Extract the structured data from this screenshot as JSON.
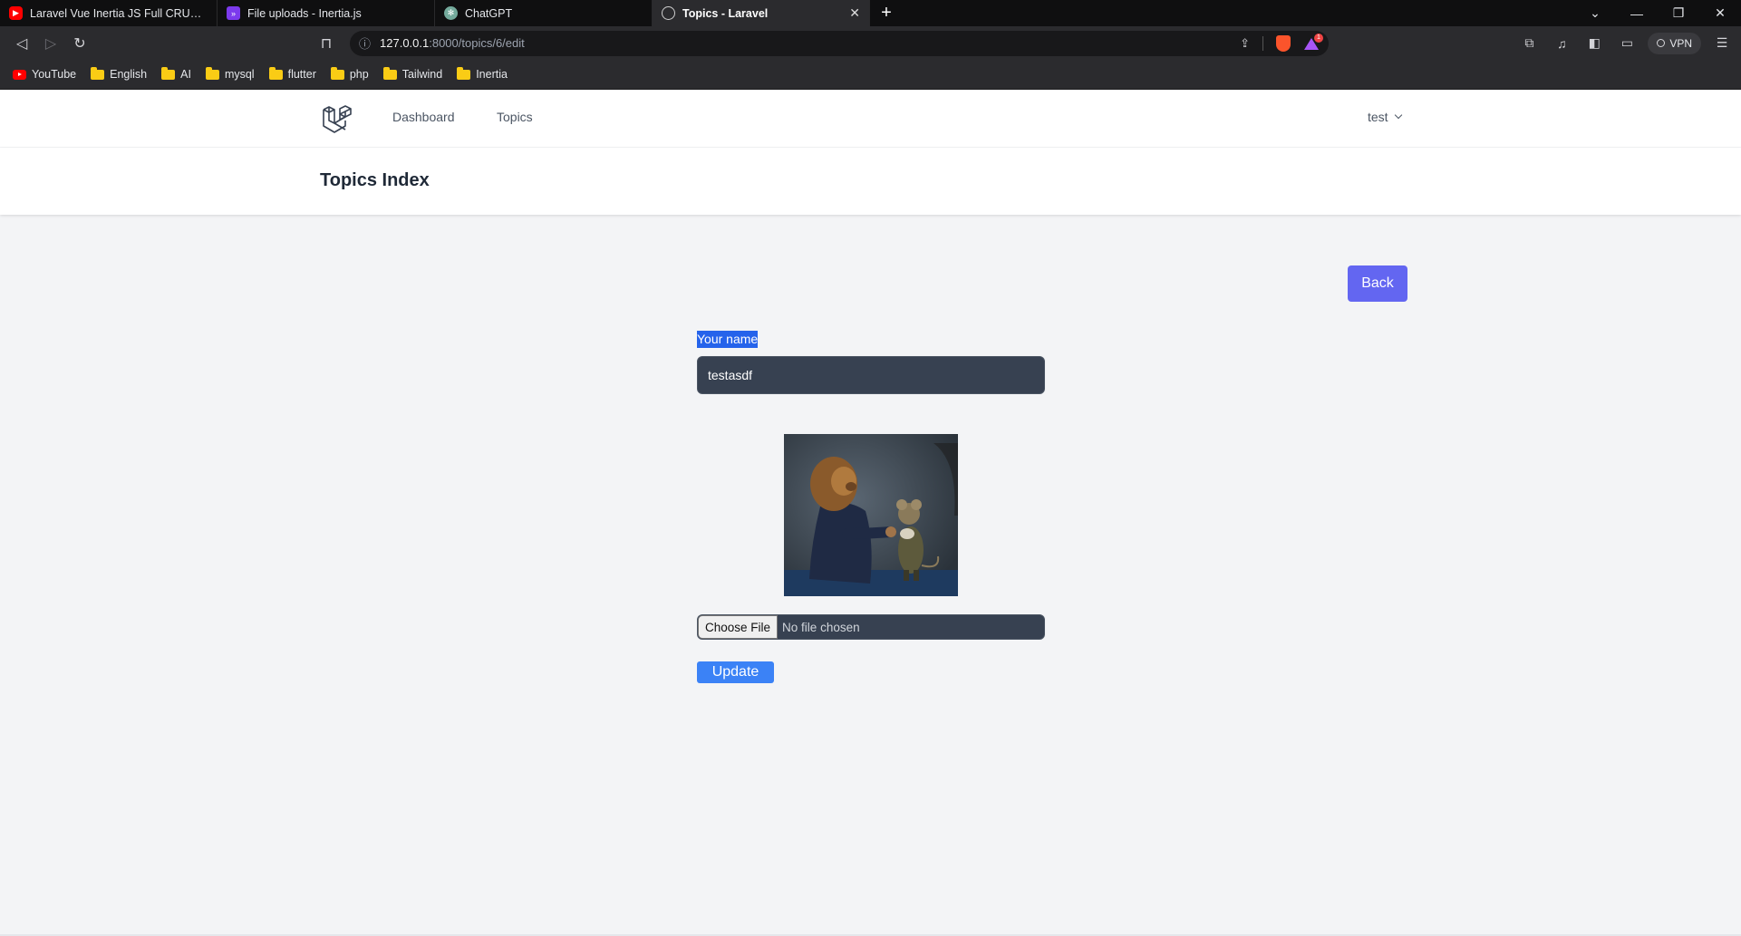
{
  "browser": {
    "tabs": [
      {
        "title": "Laravel Vue Inertia JS Full CRUD Applic",
        "favicon": "youtube-icon",
        "active": false
      },
      {
        "title": "File uploads - Inertia.js",
        "favicon": "inertia-icon",
        "active": false
      },
      {
        "title": "ChatGPT",
        "favicon": "chatgpt-icon",
        "active": false
      },
      {
        "title": "Topics - Laravel",
        "favicon": "globe-icon",
        "active": true
      }
    ],
    "url_host": "127.0.0.1",
    "url_path": ":8000/topics/6/edit",
    "vpn_label": "VPN",
    "rewards_badge": "1",
    "bookmarks": [
      {
        "label": "YouTube",
        "icon": "youtube-icon"
      },
      {
        "label": "English",
        "icon": "folder-icon"
      },
      {
        "label": "AI",
        "icon": "folder-icon"
      },
      {
        "label": "mysql",
        "icon": "folder-icon"
      },
      {
        "label": "flutter",
        "icon": "folder-icon"
      },
      {
        "label": "php",
        "icon": "folder-icon"
      },
      {
        "label": "Tailwind",
        "icon": "folder-icon"
      },
      {
        "label": "Inertia",
        "icon": "folder-icon"
      }
    ]
  },
  "app": {
    "nav": {
      "dashboard": "Dashboard",
      "topics": "Topics",
      "user": "test"
    },
    "header": {
      "title": "Topics Index"
    },
    "back_label": "Back",
    "form": {
      "name_label": "Your name",
      "name_value": "testasdf",
      "choose_file_label": "Choose File",
      "no_file_text": "No file chosen",
      "update_label": "Update"
    }
  },
  "colors": {
    "back_button": "#6366f1",
    "update_button": "#3b82f6",
    "input_bg": "#374151",
    "page_bg": "#f3f4f6"
  }
}
